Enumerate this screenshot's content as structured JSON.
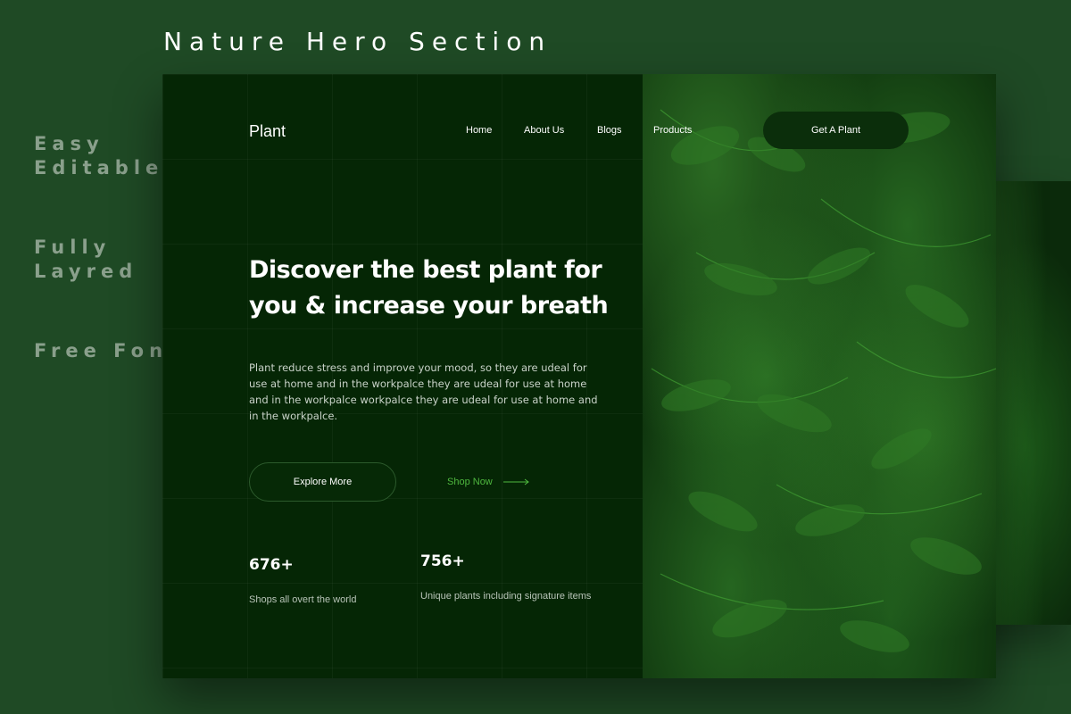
{
  "showcase": {
    "title": "Nature Hero Section",
    "features": [
      {
        "line1": "Easy",
        "line2": "Editable"
      },
      {
        "line1": "Fully",
        "line2": "Layred"
      },
      {
        "line1": "Free Fon",
        "line2": ""
      }
    ]
  },
  "header": {
    "brand": "Plant",
    "nav": [
      "Home",
      "About Us",
      "Blogs",
      "Products"
    ],
    "cta_label": "Get A Plant"
  },
  "hero": {
    "headline": "Discover the best plant for you & increase your breath",
    "description": "Plant reduce stress and improve your mood, so they are udeal for use at home and in the workpalce they are udeal for use at home and in the workpalce workpalce they are udeal for use at home and in the workpalce.",
    "primary_button": "Explore More",
    "secondary_link": "Shop Now"
  },
  "stats": [
    {
      "value": "676+",
      "label": "Shops all overt the world"
    },
    {
      "value": "756+",
      "label": "Unique plants including signature items"
    }
  ],
  "colors": {
    "background": "#1f4a25",
    "card": "#052605",
    "accent": "#4fb83f"
  }
}
